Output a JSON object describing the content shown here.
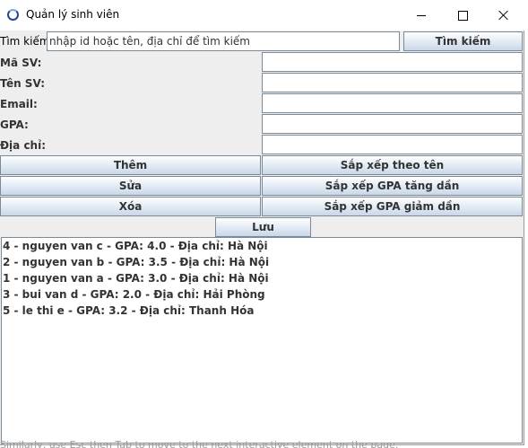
{
  "window": {
    "title": "Quản lý sinh viên",
    "icon": "java-app-icon"
  },
  "search": {
    "label": "Tìm kiếm:",
    "value": "nhập id hoặc tên, địa chỉ để tìm kiếm",
    "button": "Tìm kiếm"
  },
  "form": {
    "fields": [
      {
        "label": "Mã SV:",
        "value": ""
      },
      {
        "label": "Tên SV:",
        "value": ""
      },
      {
        "label": "Email:",
        "value": ""
      },
      {
        "label": "GPA:",
        "value": ""
      },
      {
        "label": "Địa chỉ:",
        "value": ""
      }
    ]
  },
  "buttons": {
    "add": "Thêm",
    "edit": "Sửa",
    "delete": "Xóa",
    "sort_name": "Sắp xếp theo tên",
    "sort_gpa_asc": "Sắp xếp GPA tăng dần",
    "sort_gpa_desc": "Sắp xếp GPA giảm dần",
    "save": "Lưu"
  },
  "students": [
    "4 - nguyen van c - GPA: 4.0 - Địa chỉ: Hà Nội",
    "2 - nguyen van b - GPA: 3.5 - Địa chỉ: Hà Nội",
    "1 - nguyen van a - GPA: 3.0 - Địa chỉ: Hà Nội",
    "3 - bui van d - GPA: 2.0 - Địa chỉ: Hải Phòng",
    "5 - le thi e - GPA: 3.2 - Địa chỉ: Thanh Hóa"
  ],
  "background_text": "Similarly, use Esc then Tab to move to the next interactive element on the page."
}
